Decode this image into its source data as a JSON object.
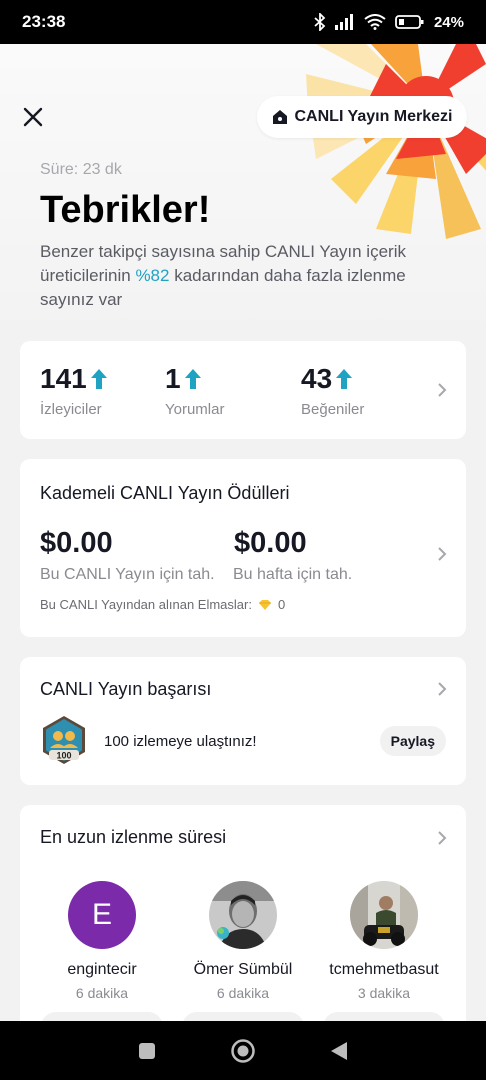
{
  "status": {
    "time": "23:38",
    "battery": "24%"
  },
  "header": {
    "center_button": "CANLI Yayın Merkezi",
    "duration": "Süre: 23 dk",
    "title": "Tebrikler!",
    "desc_before": "Benzer takipçi sayısına sahip CANLI Yayın içerik üreticilerinin ",
    "desc_pct": "%82",
    "desc_after": " kadarından daha fazla izlenme sayınız var"
  },
  "stats": [
    {
      "value": "141",
      "label": "İzleyiciler"
    },
    {
      "value": "1",
      "label": "Yorumlar"
    },
    {
      "value": "43",
      "label": "Beğeniler"
    }
  ],
  "rewards": {
    "title": "Kademeli CANLI Yayın Ödülleri",
    "amount1": "$0.00",
    "label1": "Bu CANLI Yayın için tah.",
    "amount2": "$0.00",
    "label2": "Bu hafta için tah.",
    "diamonds_label": "Bu CANLI Yayından alınan Elmaslar:",
    "diamonds_value": "0"
  },
  "success": {
    "title": "CANLI Yayın başarısı",
    "badge_number": "100",
    "milestone": "100 izlemeye ulaştınız!",
    "share": "Paylaş"
  },
  "watch_time": {
    "title": "En uzun izlenme süresi",
    "viewers": [
      {
        "avatar_letter": "E",
        "name": "engintecir",
        "time": "6 dakika"
      },
      {
        "name": "Ömer Sümbül",
        "time": "6 dakika"
      },
      {
        "name": "tcmehmetbasut",
        "time": "3 dakika"
      }
    ]
  },
  "colors": {
    "accent_teal": "#20a3c3",
    "burst_red": "#f03e2f",
    "burst_orange": "#f7a23a",
    "burst_yellow": "#fbd46a",
    "avatar_purple": "#7b2aa9"
  },
  "icons": {
    "close": "close-icon",
    "live_center": "home-live-icon",
    "up_arrow": "up-arrow-icon",
    "chevron": "chevron-right-icon",
    "diamond": "diamond-icon",
    "nav": [
      "recent-apps-icon",
      "home-icon",
      "back-icon"
    ]
  }
}
